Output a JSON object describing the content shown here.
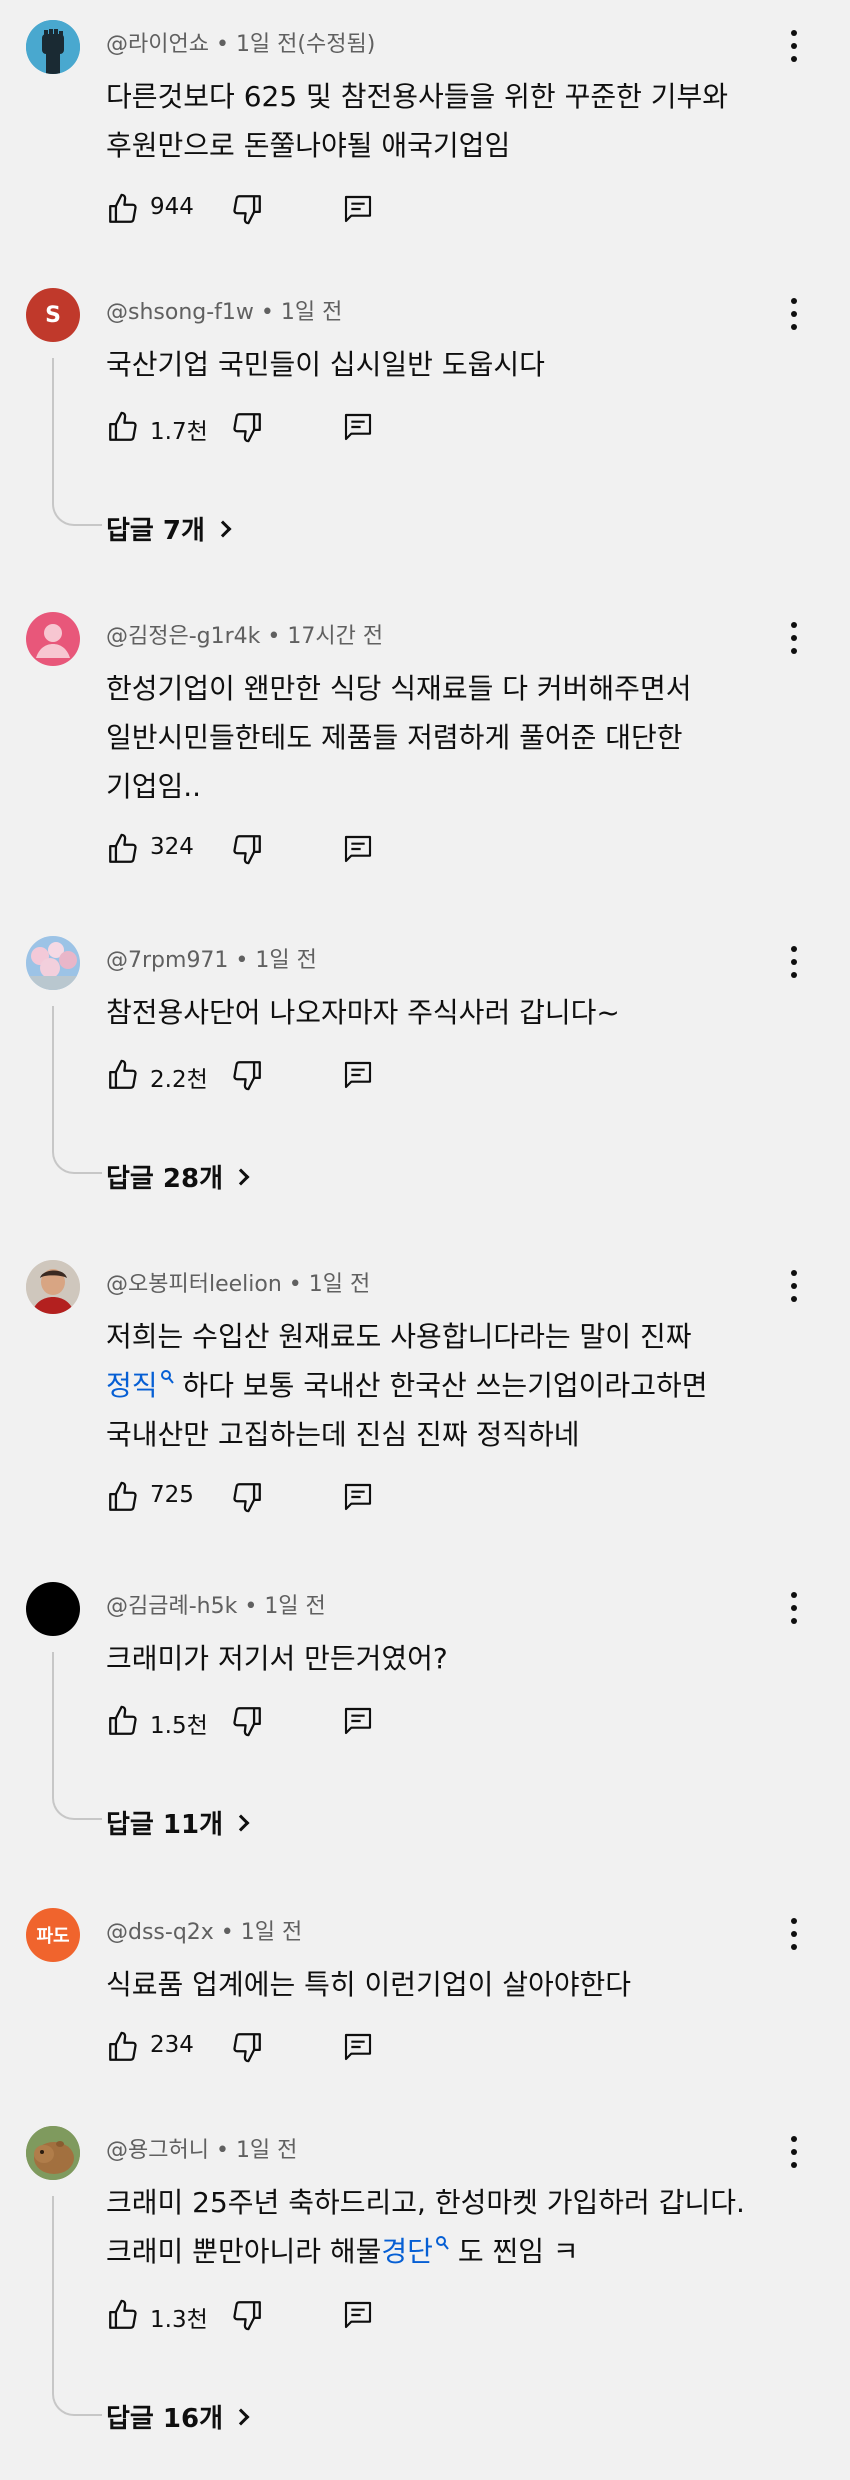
{
  "comments": [
    {
      "author": "@라이언쇼",
      "time": "1일 전(수정됨)",
      "lines": [
        "다른것보다 625 및 참전용사들을 위한 꾸준한 기부와",
        "후원만으로 돈쭐나야될 애국기업임"
      ],
      "likes": "944"
    },
    {
      "author": "@shsong-f1w",
      "time": "1일 전",
      "avatar_letter": "S",
      "lines": [
        "국산기업 국민들이 십시일반 도웁시다"
      ],
      "likes": "1.7천",
      "replies": "답글 7개"
    },
    {
      "author": "@김정은-g1r4k",
      "time": "17시간 전",
      "lines": [
        "한성기업이 왠만한 식당 식재료들 다 커버해주면서",
        "일반시민들한테도 제품들 저렴하게 풀어준 대단한",
        "기업임.."
      ],
      "likes": "324"
    },
    {
      "author": "@7rpm971",
      "time": "1일 전",
      "lines": [
        "참전용사단어 나오자마자 주식사러 갑니다~"
      ],
      "likes": "2.2천",
      "replies": "답글 28개"
    },
    {
      "author": "@오봉피터leelion",
      "time": "1일 전",
      "lines": [
        "저희는 수입산 원재료도 사용합니다라는 말이 진짜"
      ],
      "line2_link": "정직",
      "line2_rest": " 하다 보통 국내산 한국산 쓰는기업이라고하면",
      "line3": "국내산만 고집하는데 진심 진짜 정직하네",
      "likes": "725"
    },
    {
      "author": "@김금례-h5k",
      "time": "1일 전",
      "lines": [
        "크래미가 저기서 만든거였어?"
      ],
      "likes": "1.5천",
      "replies": "답글 11개"
    },
    {
      "author": "@dss-q2x",
      "time": "1일 전",
      "avatar_letter": "파도",
      "lines": [
        "식료품 업계에는 특히 이런기업이 살아야한다"
      ],
      "likes": "234"
    },
    {
      "author": "@용그허니",
      "time": "1일 전",
      "lines": [
        "크래미 25주년 축하드리고, 한성마켓 가입하러 갑니다."
      ],
      "line2_pre": "크래미 뿐만아니라 해물",
      "line2_link": "경단",
      "line2_rest": " 도 찐임 ㅋ",
      "likes": "1.3천",
      "replies": "답글 16개"
    }
  ],
  "colors": {
    "background": "#f1f1f1",
    "text": "#0f0f0f",
    "meta": "#606060",
    "link": "#065fd4",
    "avatar_s": "#c0392b",
    "avatar_pink": "#e8577a",
    "avatar_pado": "#f0642d"
  },
  "icons": [
    "profile-avatar",
    "like-icon",
    "dislike-icon",
    "reply-icon",
    "more-vert-icon",
    "chevron-right-icon",
    "search-icon"
  ]
}
